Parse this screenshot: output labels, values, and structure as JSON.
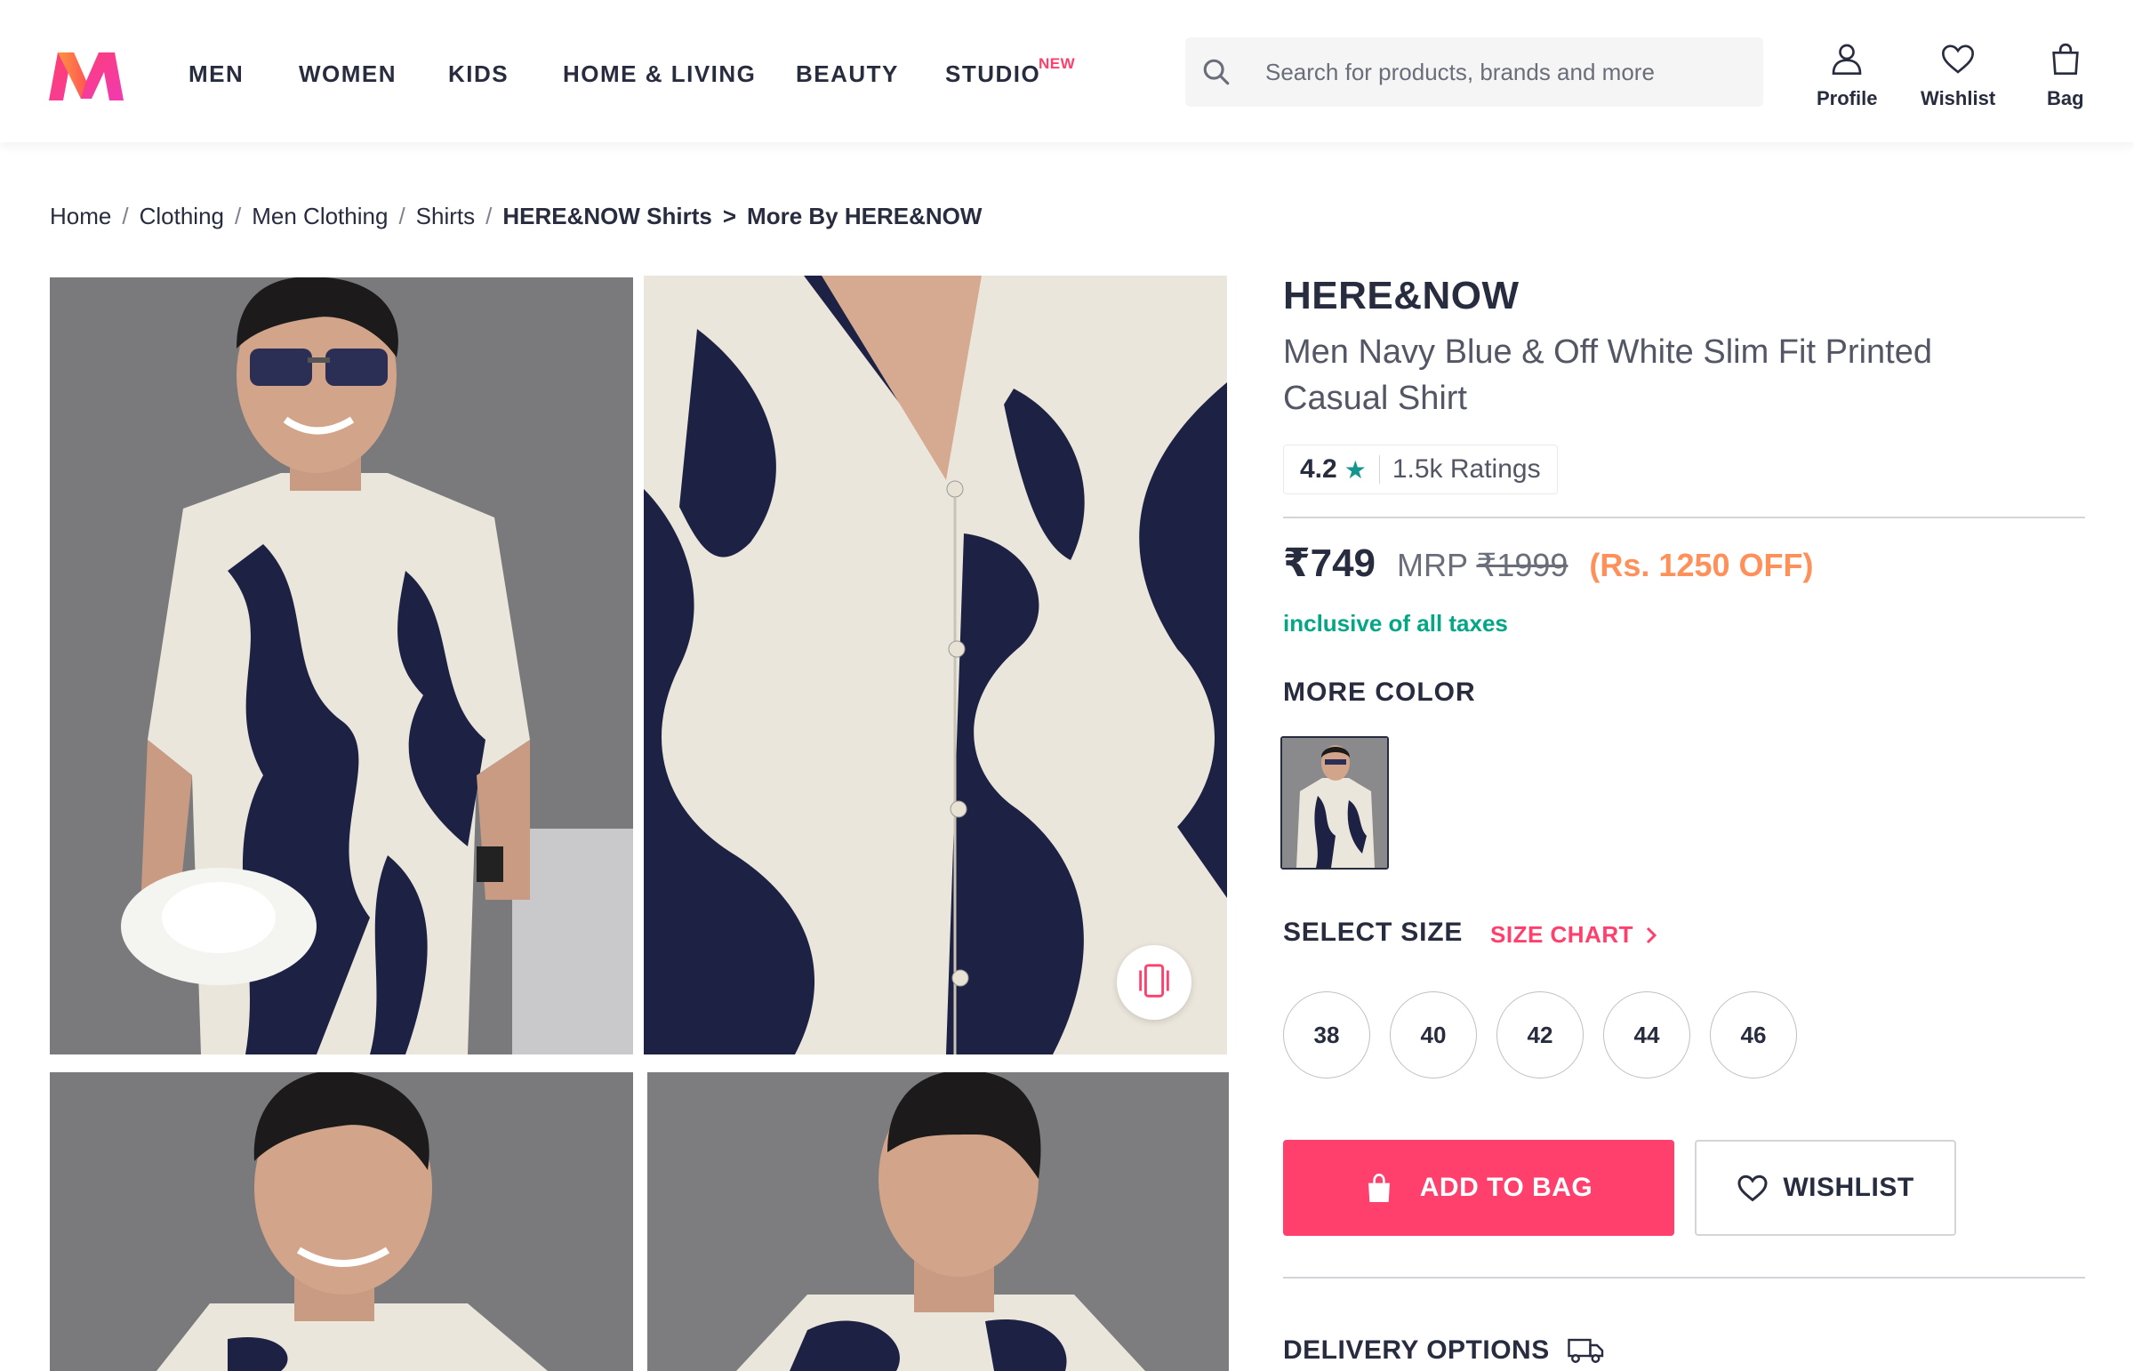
{
  "header": {
    "logo_icon": "myntra-logo-icon",
    "nav": [
      {
        "label": "MEN"
      },
      {
        "label": "WOMEN"
      },
      {
        "label": "KIDS"
      },
      {
        "label": "HOME & LIVING"
      },
      {
        "label": "BEAUTY"
      },
      {
        "label": "STUDIO",
        "badge": "NEW"
      }
    ],
    "search": {
      "placeholder": "Search for products, brands and more",
      "icon": "search-icon"
    },
    "actions": [
      {
        "label": "Profile",
        "icon": "profile-icon"
      },
      {
        "label": "Wishlist",
        "icon": "heart-icon"
      },
      {
        "label": "Bag",
        "icon": "bag-icon"
      }
    ]
  },
  "breadcrumb": {
    "items": [
      "Home",
      "Clothing",
      "Men Clothing",
      "Shirts"
    ],
    "current": "HERE&NOW Shirts",
    "more": "More By HERE&NOW"
  },
  "product": {
    "brand": "HERE&NOW",
    "name": "Men Navy Blue & Off White Slim Fit Printed Casual Shirt",
    "rating": {
      "value": "4.2",
      "count": "1.5k Ratings"
    },
    "price": "₹749",
    "mrp_label": "MRP",
    "mrp": "₹1999",
    "discount": "(Rs. 1250 OFF)",
    "tax_note": "inclusive of all taxes",
    "more_color_label": "MORE COLOR",
    "select_size_label": "SELECT SIZE",
    "size_chart_label": "SIZE CHART",
    "sizes": [
      "38",
      "40",
      "42",
      "44",
      "46"
    ],
    "add_to_bag_label": "ADD TO BAG",
    "wishlist_label": "WISHLIST",
    "delivery_label": "DELIVERY OPTIONS"
  },
  "colors": {
    "accent": "#ff3f6c",
    "discount": "#ff905a",
    "tax": "#03a685",
    "rating_star": "#14958f",
    "shirt_navy": "#1d2244",
    "shirt_cream": "#ebe6dc"
  }
}
